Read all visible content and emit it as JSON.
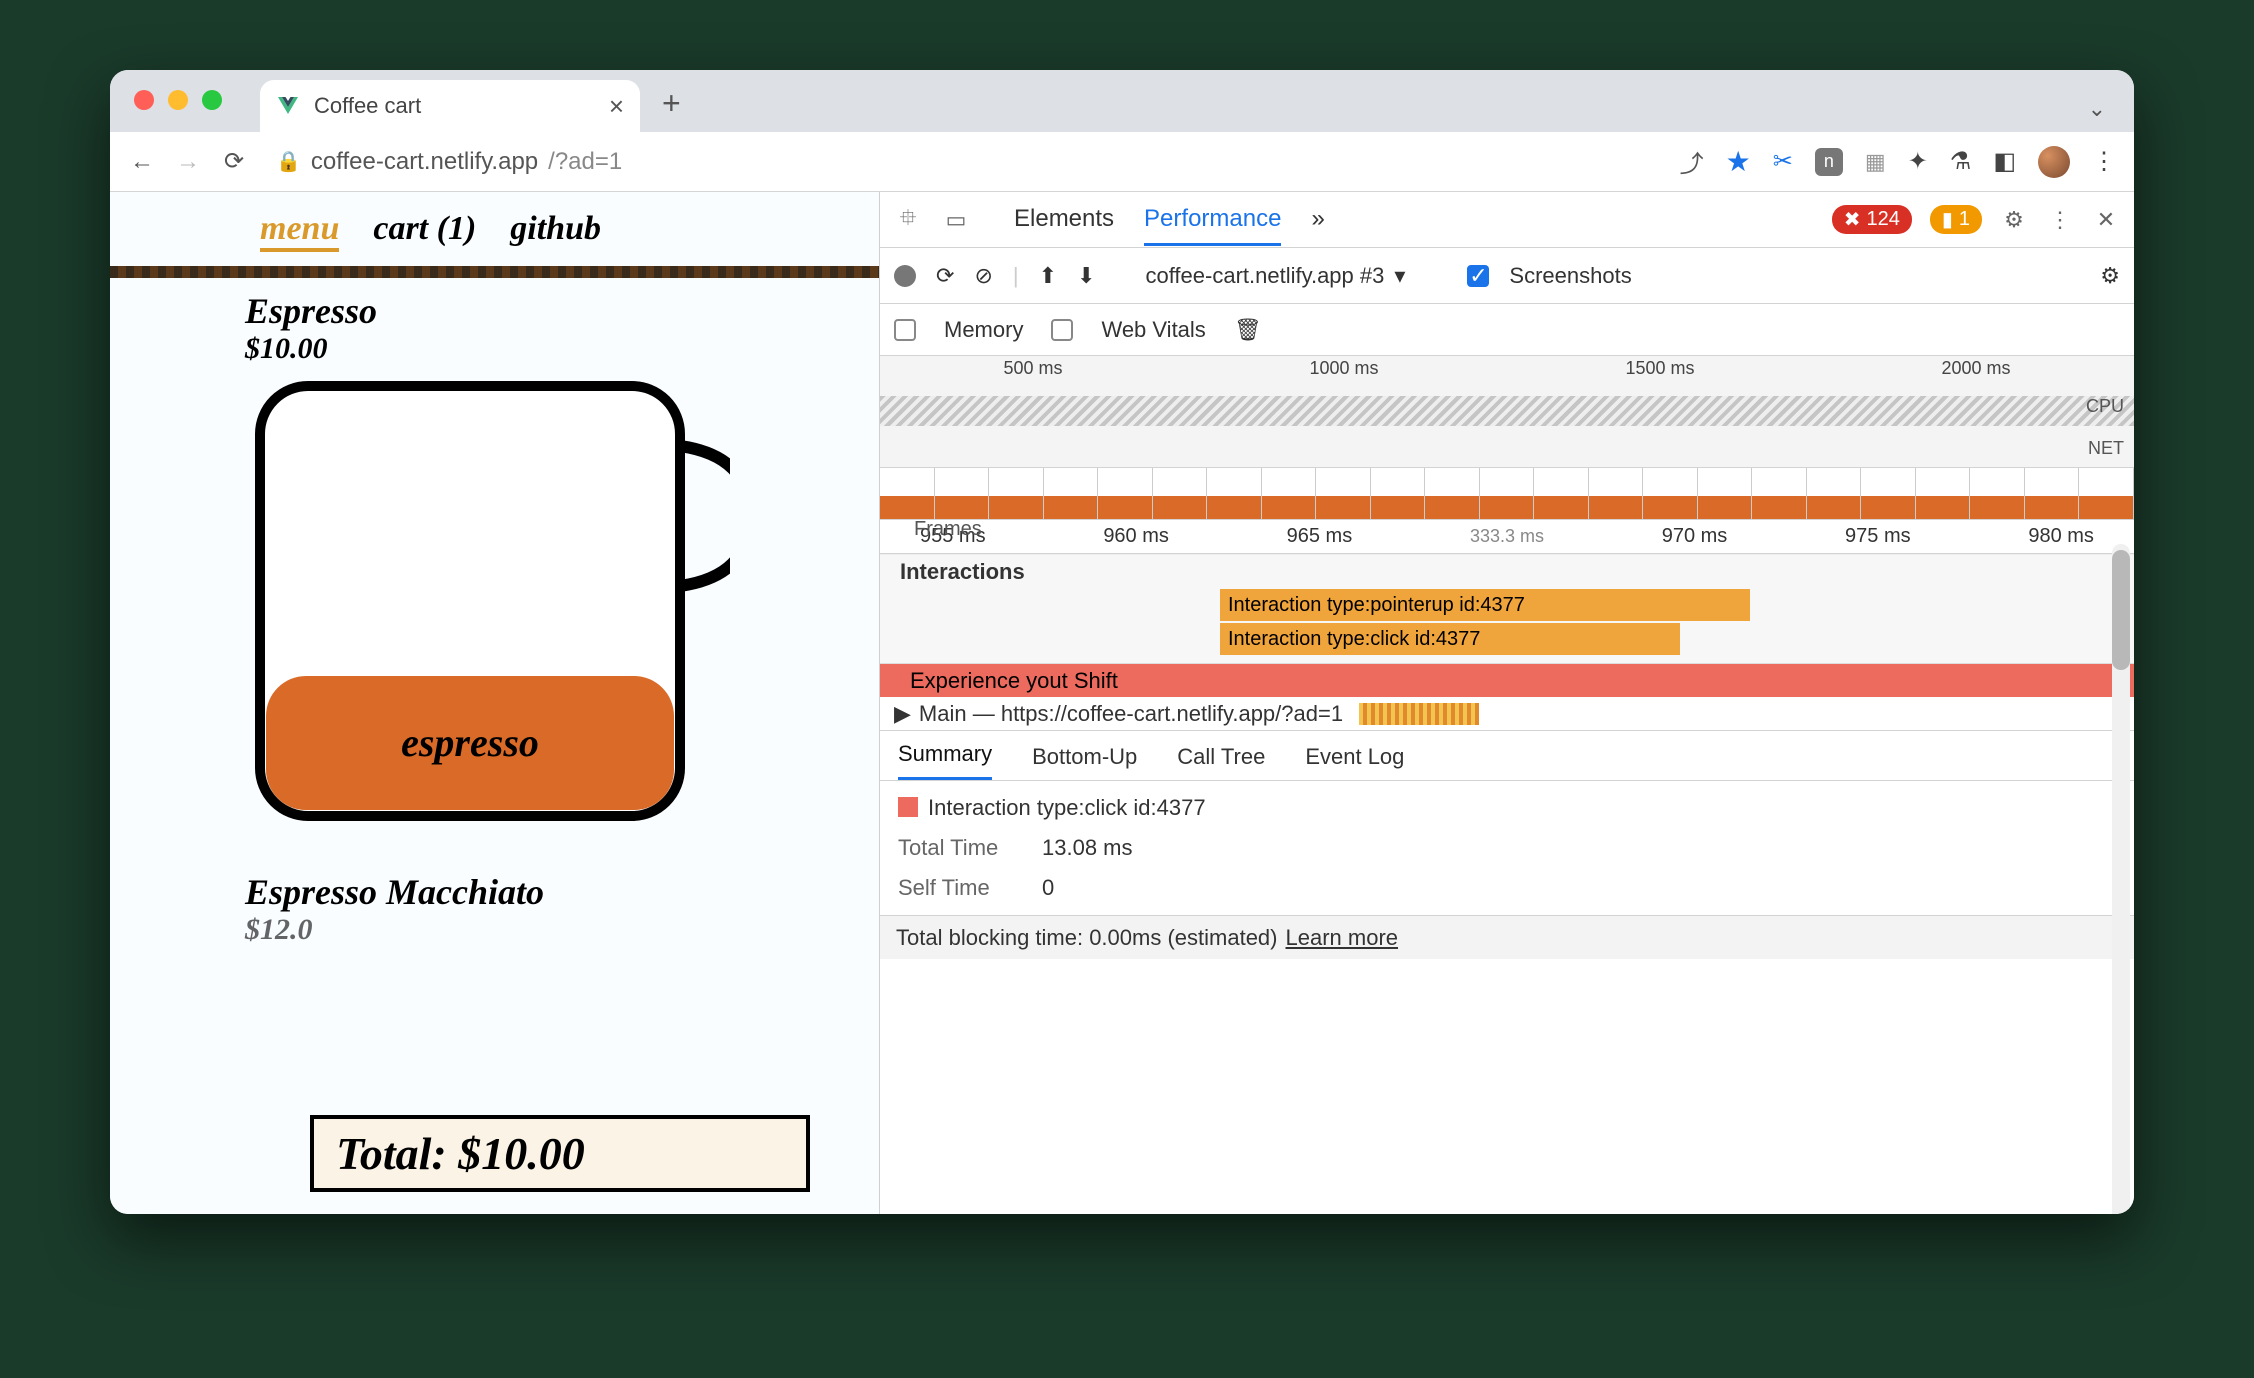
{
  "browser": {
    "tab_title": "Coffee cart",
    "url_host": "coffee-cart.netlify.app",
    "url_path": "/?ad=1"
  },
  "page": {
    "nav": {
      "menu": "menu",
      "cart": "cart (1)",
      "github": "github"
    },
    "item1_name": "Espresso",
    "item1_price": "$10.00",
    "fill_label": "espresso",
    "item2_name": "Espresso Macchiato",
    "item2_price": "$12.0",
    "total_label": "Total: $10.00"
  },
  "devtools": {
    "tabs": {
      "elements": "Elements",
      "performance": "Performance",
      "more": "»"
    },
    "errors": "124",
    "warnings": "1",
    "recording_label": "coffee-cart.netlify.app #3",
    "screenshots_label": "Screenshots",
    "memory_label": "Memory",
    "webvitals_label": "Web Vitals",
    "overview_ticks": [
      "500 ms",
      "1000 ms",
      "1500 ms",
      "2000 ms"
    ],
    "overview_cpu": "CPU",
    "overview_net": "NET",
    "ruler": [
      "955 ms",
      "960 ms",
      "965 ms",
      "970 ms",
      "975 ms",
      "980 ms"
    ],
    "ruler_hint": "333.3 ms",
    "frames_label": "Frames",
    "interactions_label": "Interactions",
    "bar1": "Interaction type:pointerup id:4377",
    "bar2": "Interaction type:click id:4377",
    "experience_row": "Experience   yout Shift",
    "main_row": "Main — https://coffee-cart.netlify.app/?ad=1",
    "subtabs": {
      "summary": "Summary",
      "bottomup": "Bottom-Up",
      "calltree": "Call Tree",
      "eventlog": "Event Log"
    },
    "summary_title": "Interaction type:click id:4377",
    "total_time_label": "Total Time",
    "total_time_value": "13.08 ms",
    "self_time_label": "Self Time",
    "self_time_value": "0",
    "tbt_text": "Total blocking time: 0.00ms (estimated)",
    "tbt_link": "Learn more"
  }
}
